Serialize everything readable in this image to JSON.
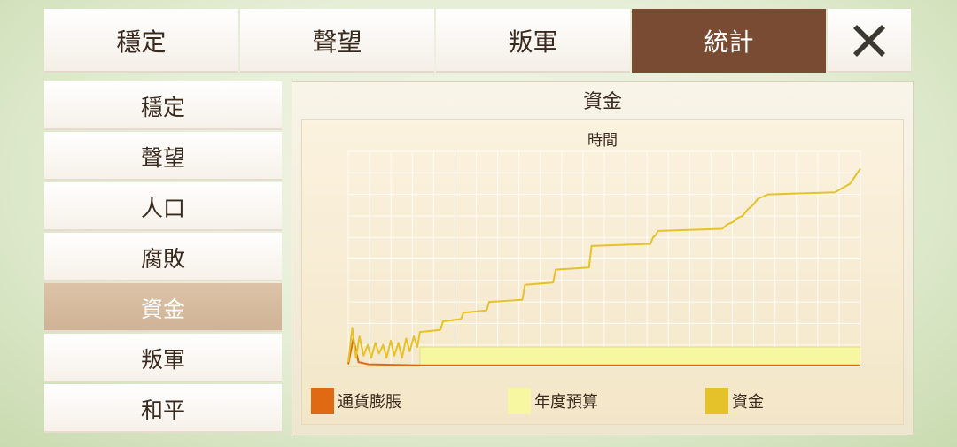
{
  "tabs": [
    {
      "label": "穩定"
    },
    {
      "label": "聲望"
    },
    {
      "label": "叛軍"
    },
    {
      "label": "統計",
      "active": true
    }
  ],
  "close_icon": "close-x-icon",
  "sidebar": {
    "items": [
      {
        "label": "穩定"
      },
      {
        "label": "聲望"
      },
      {
        "label": "人口"
      },
      {
        "label": "腐敗"
      },
      {
        "label": "資金",
        "active": true
      },
      {
        "label": "叛軍"
      },
      {
        "label": "和平"
      }
    ]
  },
  "panel": {
    "title": "資金"
  },
  "colors": {
    "active_tab": "#7a4b33",
    "active_side": "#d3b99c",
    "inflation": "#e06a14",
    "budget": "#f7f7a2",
    "funds": "#e6c22a",
    "grid": "#ffffff"
  },
  "chart_data": {
    "type": "line",
    "title": "資金",
    "xlabel": "時間",
    "ylabel": "",
    "grid": true,
    "legend_position": "bottom",
    "xlim": [
      0,
      100
    ],
    "ylim": [
      0,
      100
    ],
    "series": [
      {
        "name": "通貨膨脹",
        "color": "#e06a14",
        "x": [
          0,
          1,
          2,
          4,
          14,
          100
        ],
        "y": [
          1,
          13,
          2,
          1,
          0.5,
          0.5
        ]
      },
      {
        "name": "年度預算",
        "color": "#f7f7a2",
        "band": [
          0.8,
          9
        ],
        "x": [
          0,
          14,
          14,
          100
        ],
        "y": [
          0,
          0,
          9,
          9
        ]
      },
      {
        "name": "資金",
        "color": "#e6c22a",
        "x": [
          0,
          0.8,
          1.5,
          2.2,
          3,
          3.8,
          4.5,
          5.3,
          6,
          6.8,
          7.5,
          8.3,
          9,
          9.8,
          10.5,
          11.3,
          12,
          12.8,
          13.5,
          14,
          18,
          18.5,
          22,
          22.5,
          27,
          27.5,
          34,
          34.5,
          40,
          40.5,
          47,
          47.5,
          59,
          59.5,
          60,
          60.5,
          73,
          74,
          75,
          76,
          77,
          78,
          79,
          80,
          82,
          95,
          98,
          100
        ],
        "y": [
          2,
          18,
          4,
          14,
          5,
          10,
          4,
          11,
          6,
          10,
          4,
          12,
          5,
          11,
          4,
          13,
          7,
          14,
          9,
          16,
          17,
          21,
          22,
          25,
          26,
          30,
          31,
          38,
          39,
          45,
          46,
          56,
          57,
          60,
          61,
          63,
          64,
          66,
          67,
          69,
          70,
          73,
          75,
          78,
          80,
          81,
          85,
          92
        ]
      }
    ]
  }
}
